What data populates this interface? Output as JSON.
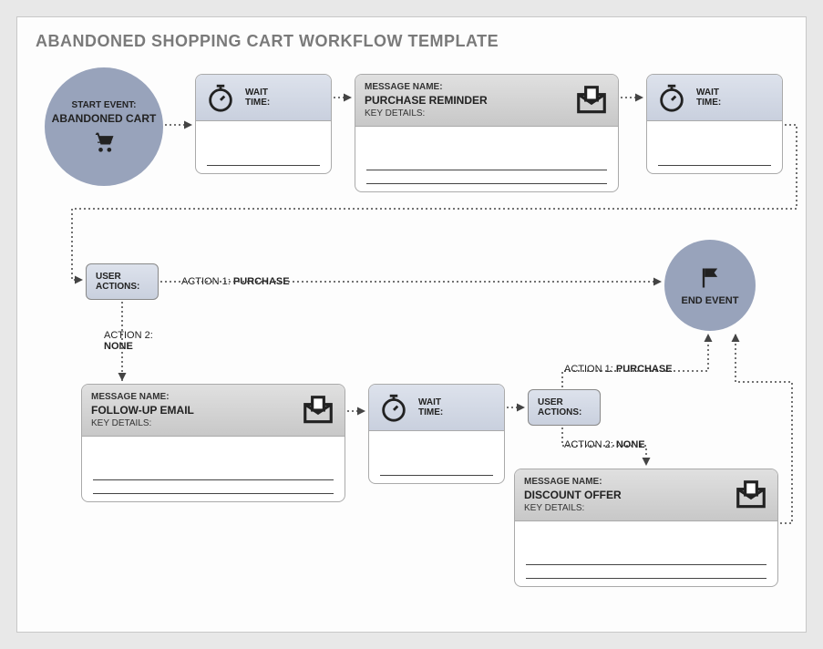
{
  "title": "ABANDONED SHOPPING CART WORKFLOW TEMPLATE",
  "start": {
    "label": "START EVENT:",
    "name": "ABANDONED CART"
  },
  "end": {
    "name": "END EVENT"
  },
  "wait": {
    "label1": "WAIT",
    "label2": "TIME:"
  },
  "msg1": {
    "label": "MESSAGE NAME:",
    "name": "PURCHASE REMINDER",
    "key": "KEY DETAILS:"
  },
  "msg2": {
    "label": "MESSAGE NAME:",
    "name": "FOLLOW-UP EMAIL",
    "key": "KEY DETAILS:"
  },
  "msg3": {
    "label": "MESSAGE NAME:",
    "name": "DISCOUNT OFFER",
    "key": "KEY DETAILS:"
  },
  "userActions": {
    "line1": "USER",
    "line2": "ACTIONS:"
  },
  "decisions": {
    "a1": "ACTION 1:",
    "purchase": "PURCHASE",
    "a2": "ACTION 2:",
    "none": "NONE"
  }
}
